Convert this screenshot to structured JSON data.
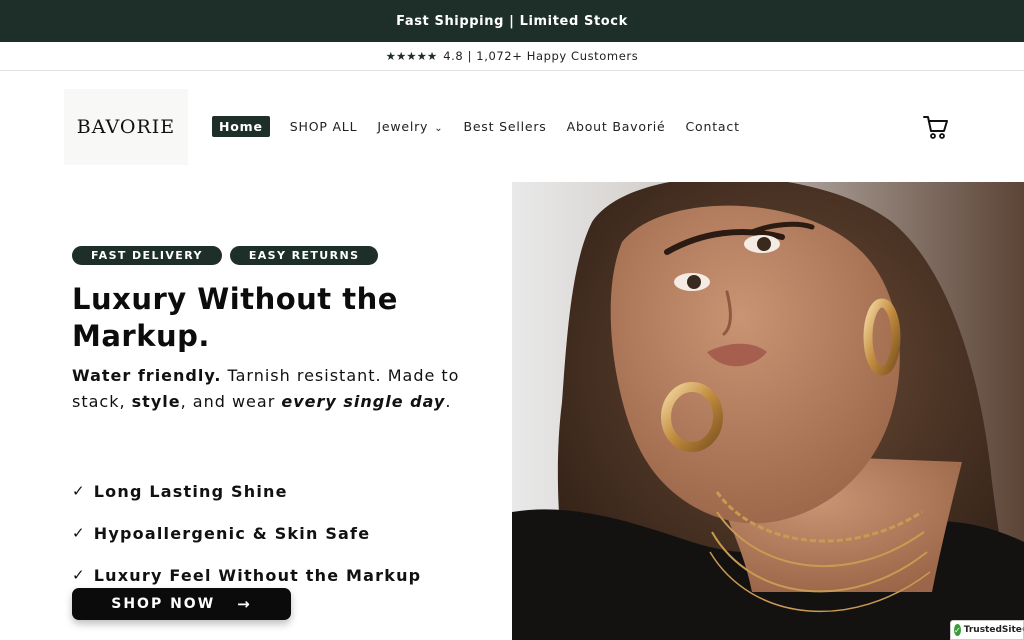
{
  "announcement": {
    "text": "Fast Shipping | Limited Stock"
  },
  "rating_bar": {
    "stars": "★★★★★",
    "text": "4.8 | 1,072+ Happy Customers"
  },
  "header": {
    "logo": "BAVORIE",
    "nav": [
      {
        "label": "Home",
        "active": true
      },
      {
        "label": "SHOP ALL"
      },
      {
        "label": "Jewelry",
        "has_dropdown": true
      },
      {
        "label": "Best Sellers"
      },
      {
        "label": "About Bavorié"
      },
      {
        "label": "Contact"
      }
    ],
    "cart_icon": "cart-icon"
  },
  "hero": {
    "badges": [
      "FAST DELIVERY",
      "EASY RETURNS"
    ],
    "headline_line1": "Luxury Without the",
    "headline_line2": "Markup.",
    "sub": {
      "part1_bold": "Water friendly.",
      "part2": " Tarnish resistant. Made to stack, ",
      "part3_bold": "style",
      "part4": ", and wear ",
      "part5_bold_italic": "every single day",
      "part6": "."
    },
    "features": [
      "Long Lasting Shine",
      "Hypoallergenic & Skin Safe",
      "Luxury Feel Without the Markup"
    ],
    "check_glyph": "✓",
    "cta": {
      "label": "SHOP NOW",
      "arrow": "→"
    }
  },
  "trust_badge": {
    "text": "TrustedSite",
    "mark": "®"
  },
  "colors": {
    "brand_dark": "#1e2f2a",
    "button_black": "#0b0b0b",
    "gold": "#c99a52"
  }
}
